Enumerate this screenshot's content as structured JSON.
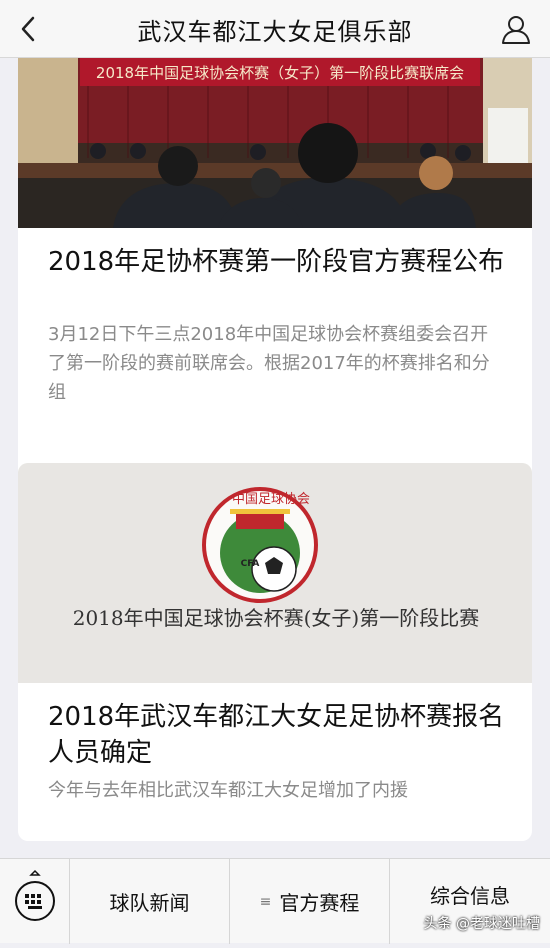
{
  "header": {
    "title": "武汉车都江大女足俱乐部"
  },
  "articles": [
    {
      "banner_text": "2018年中国足球协会杯赛（女子）第一阶段比赛联席会",
      "title": "2018年足协杯赛第一阶段官方赛程公布",
      "summary": "3月12日下午三点2018年中国足球协会杯赛组委会召开了第一阶段的赛前联席会。根据2017年的杯赛排名和分组"
    },
    {
      "logo_ring_text": "中国足球协会",
      "logo_badge_text": "CFA",
      "doc_heading": "2018年中国足球协会杯赛(女子)第一阶段比赛",
      "title": "2018年武汉车都江大女足足协杯赛报名人员确定",
      "summary": "今年与去年相比武汉车都江大女足增加了内援"
    }
  ],
  "tabbar": {
    "tabs": [
      {
        "label": "球队新闻"
      },
      {
        "label": "官方赛程",
        "icon": "menu-icon"
      },
      {
        "label": "综合信息"
      }
    ]
  },
  "watermark": "头条 @老球迷吐槽",
  "colors": {
    "banner_red": "#b0182b",
    "logo_green": "#3e8a3a",
    "logo_red": "#c0272d"
  }
}
